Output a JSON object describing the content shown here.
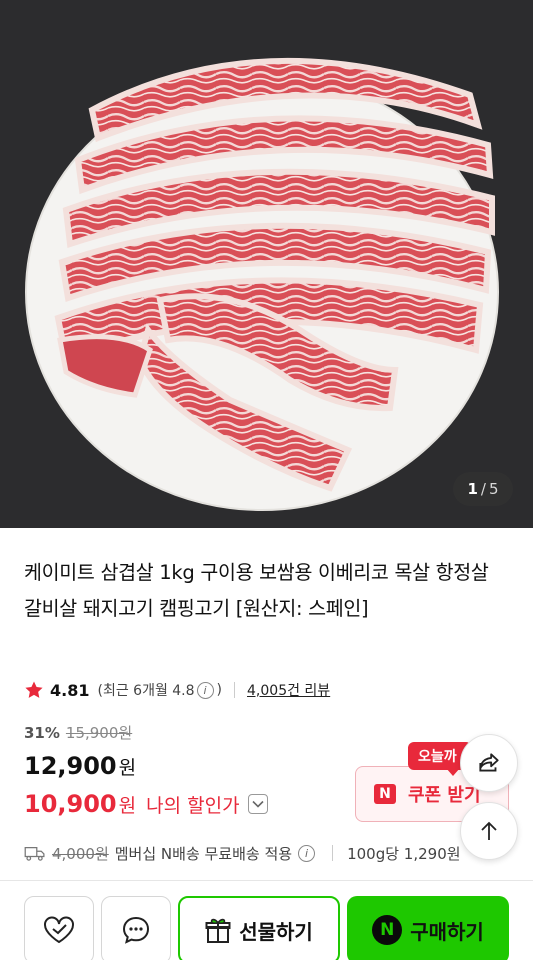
{
  "product": {
    "image": {
      "name": "pork-belly-on-white-plate",
      "current": "1",
      "separator": "/",
      "total": "5"
    },
    "title": "케이미트 삼겹살 1kg 구이용 보쌈용 이베리코 목살 항정살 갈비살 돼지고기 캠핑고기 [원산지: 스페인]"
  },
  "rating": {
    "score": "4.81",
    "recent_prefix": "(최근 6개월 4.8",
    "info_glyph": "i",
    "recent_suffix": ")",
    "reviews": "4,005건 리뷰",
    "star_color": "#e8293b"
  },
  "price": {
    "discount_rate": "31%",
    "original": "15,900원",
    "sale": "12,900",
    "sale_unit": "원",
    "my_price": "10,900",
    "my_price_unit": "원",
    "my_price_label": "나의 할인가"
  },
  "coupon": {
    "badge": "오늘까",
    "logo": "N",
    "label": "쿠폰 받기"
  },
  "delivery": {
    "original_fee": "4,000원",
    "text": "멤버십 N배송 무료배송 적용",
    "unit_price": "100g당 1,290원"
  },
  "bottom_bar": {
    "gift_label": "선물하기",
    "buy_logo": "N",
    "buy_label": "구매하기"
  },
  "colors": {
    "accent_red": "#e8293b",
    "naver_green": "#1ec800",
    "hero_background": "#2c2c2e"
  },
  "icons": [
    "star-icon",
    "info-icon",
    "chevron-down-icon",
    "share-icon",
    "arrow-up-icon",
    "truck-icon",
    "heart-check-icon",
    "chat-icon",
    "gift-icon"
  ]
}
